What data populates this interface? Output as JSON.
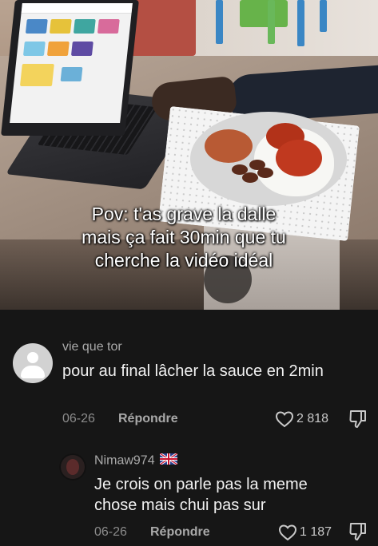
{
  "video": {
    "caption": "Pov: t'as grave la dalle\nmais ça fait 30min que tu\ncherche la vidéo idéal"
  },
  "comments": [
    {
      "username": "vie que tor",
      "text": "pour au final lâcher la sauce en 2min",
      "date": "06-26",
      "reply_label": "Répondre",
      "likes": "2 818",
      "avatar_icon": "default-avatar-icon"
    },
    {
      "username": "Nimaw974",
      "username_badge_icon": "uk-flag-icon",
      "text": "Je crois on parle pas la meme chose mais chui pas sur",
      "date": "06-26",
      "reply_label": "Répondre",
      "likes": "1 187",
      "avatar_icon": "user-avatar-icon"
    }
  ],
  "colors": {
    "background": "#161616",
    "username": "#a9a9a9",
    "comment_text": "#f1f1f1",
    "meta": "#8c8c8c"
  }
}
